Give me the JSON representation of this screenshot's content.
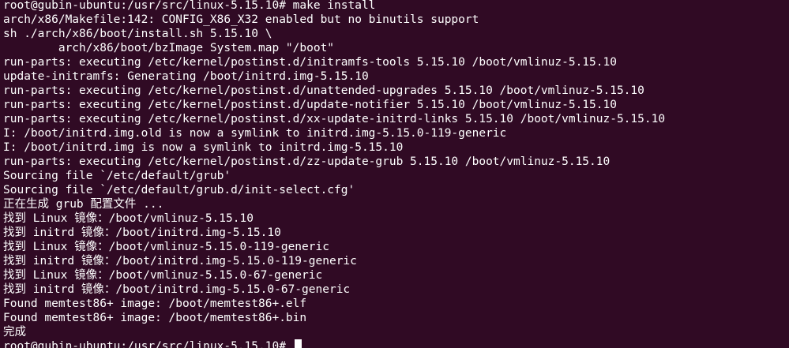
{
  "terminal": {
    "lines": [
      "root@gubin-ubuntu:/usr/src/linux-5.15.10# make install",
      "arch/x86/Makefile:142: CONFIG_X86_X32 enabled but no binutils support",
      "sh ./arch/x86/boot/install.sh 5.15.10 \\",
      "        arch/x86/boot/bzImage System.map \"/boot\"",
      "run-parts: executing /etc/kernel/postinst.d/initramfs-tools 5.15.10 /boot/vmlinuz-5.15.10",
      "update-initramfs: Generating /boot/initrd.img-5.15.10",
      "run-parts: executing /etc/kernel/postinst.d/unattended-upgrades 5.15.10 /boot/vmlinuz-5.15.10",
      "run-parts: executing /etc/kernel/postinst.d/update-notifier 5.15.10 /boot/vmlinuz-5.15.10",
      "run-parts: executing /etc/kernel/postinst.d/xx-update-initrd-links 5.15.10 /boot/vmlinuz-5.15.10",
      "I: /boot/initrd.img.old is now a symlink to initrd.img-5.15.0-119-generic",
      "I: /boot/initrd.img is now a symlink to initrd.img-5.15.10",
      "run-parts: executing /etc/kernel/postinst.d/zz-update-grub 5.15.10 /boot/vmlinuz-5.15.10",
      "Sourcing file `/etc/default/grub'",
      "Sourcing file `/etc/default/grub.d/init-select.cfg'",
      "正在生成 grub 配置文件 ...",
      "找到 Linux 镜像：/boot/vmlinuz-5.15.10",
      "找到 initrd 镜像：/boot/initrd.img-5.15.10",
      "找到 Linux 镜像：/boot/vmlinuz-5.15.0-119-generic",
      "找到 initrd 镜像：/boot/initrd.img-5.15.0-119-generic",
      "找到 Linux 镜像：/boot/vmlinuz-5.15.0-67-generic",
      "找到 initrd 镜像：/boot/initrd.img-5.15.0-67-generic",
      "Found memtest86+ image: /boot/memtest86+.elf",
      "Found memtest86+ image: /boot/memtest86+.bin",
      "完成"
    ],
    "prompt": "root@gubin-ubuntu:/usr/src/linux-5.15.10#"
  },
  "colors": {
    "background": "#300a24",
    "foreground": "#ffffff"
  }
}
